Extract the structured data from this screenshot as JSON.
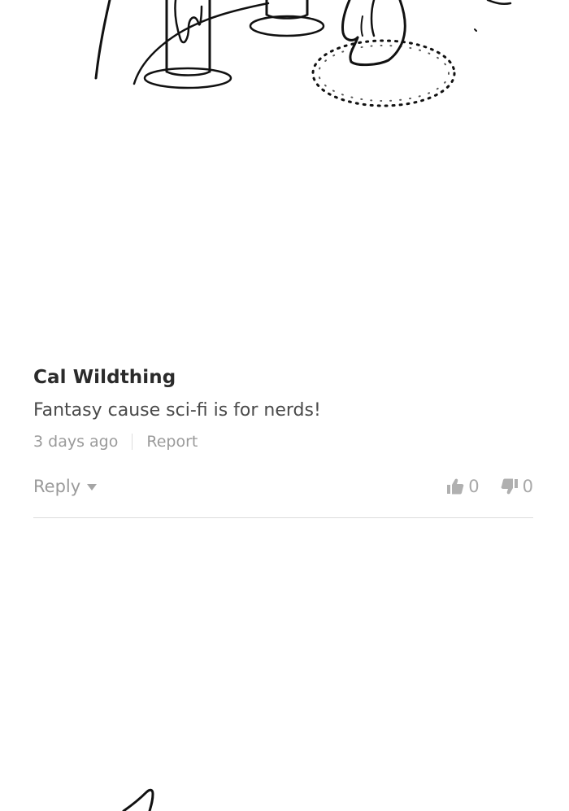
{
  "comment": {
    "author": "Cal Wildthing",
    "text": "Fantasy cause sci-fi is for nerds!",
    "timestamp": "3 days ago",
    "report_label": "Report",
    "reply_label": "Reply",
    "upvotes": "0",
    "downvotes": "0"
  },
  "icons": {
    "upvote": "thumbs-up-icon",
    "downvote": "thumbs-down-icon",
    "reply_caret": "chevron-down-icon"
  },
  "colors": {
    "author": "#2b2b2b",
    "text": "#4a4a4a",
    "muted": "#9a9a9a",
    "divider": "#dcdcdc"
  }
}
